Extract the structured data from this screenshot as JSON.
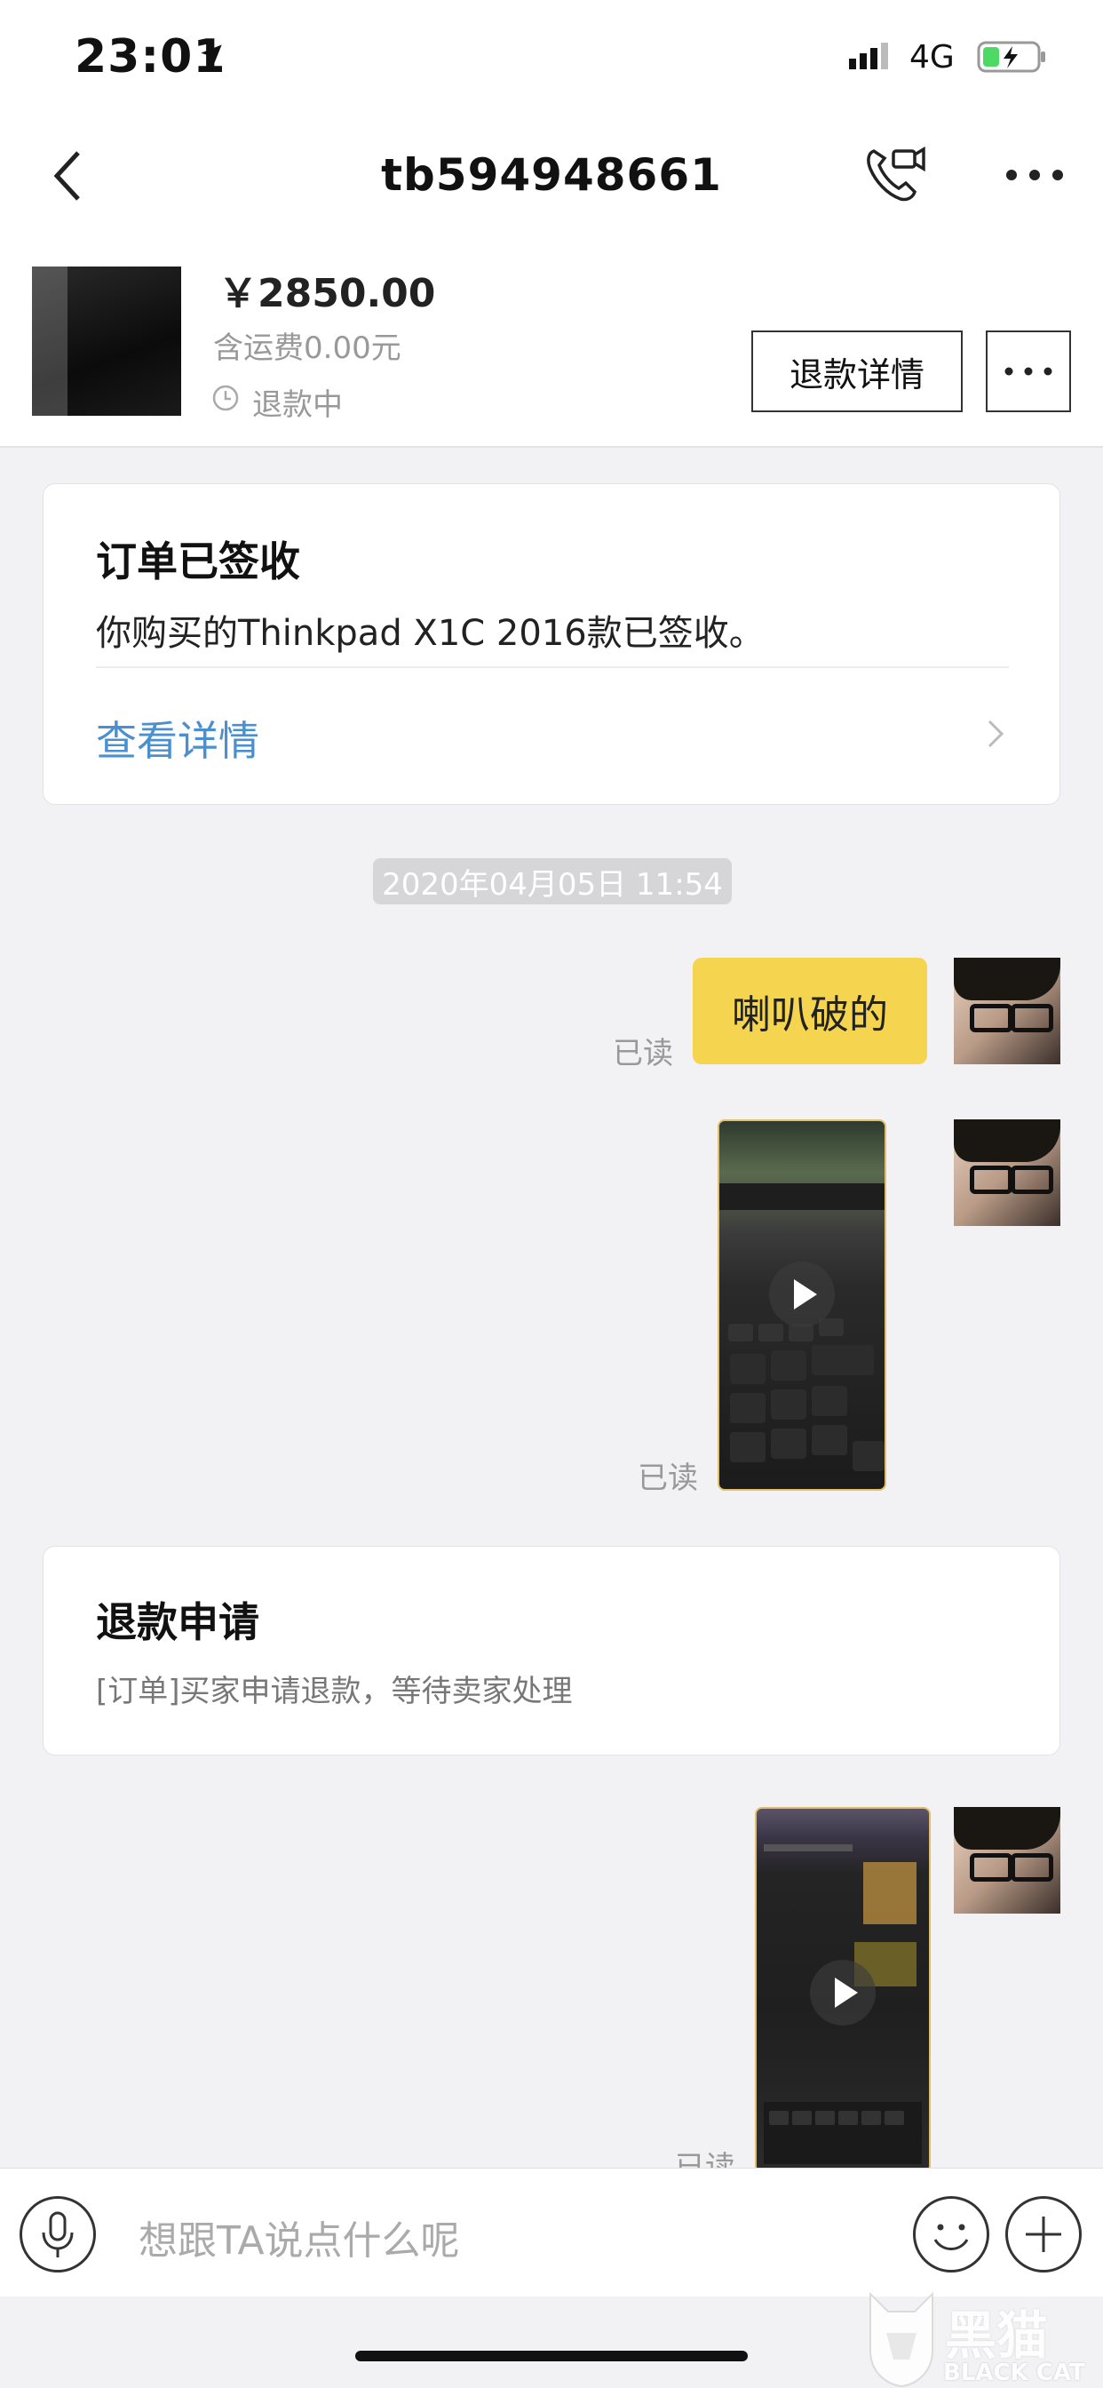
{
  "status_bar": {
    "time": "23:01",
    "network": "4G"
  },
  "nav": {
    "title": "tb594948661"
  },
  "product": {
    "price": "￥2850.00",
    "shipping": "含运费0.00元",
    "status": "退款中",
    "detail_button": "退款详情"
  },
  "order_card": {
    "title": "订单已签收",
    "text": "你购买的Thinkpad X1C 2016款已签收。",
    "link": "查看详情"
  },
  "chat": {
    "timestamp": "2020年04月05日 11:54",
    "message_text": "喇叭破的",
    "read_label": "已读"
  },
  "refund_card": {
    "title": "退款申请",
    "text": "[订单]买家申请退款，等待卖家处理"
  },
  "input": {
    "placeholder": "想跟TA说点什么呢"
  },
  "watermark": {
    "brand": "黑猫",
    "brand_en": "BLACK CAT"
  },
  "colors": {
    "accent_yellow": "#f5d54f",
    "link_blue": "#4a90d0",
    "battery_green": "#4cd964"
  }
}
